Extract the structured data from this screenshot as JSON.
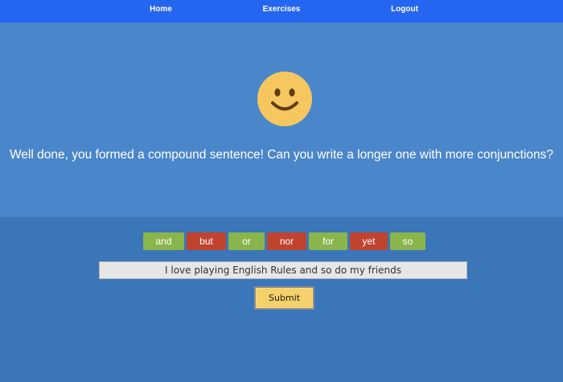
{
  "nav": {
    "home": "Home",
    "exercises": "Exercises",
    "logout": "Logout"
  },
  "feedback": {
    "icon": "smiley-face-icon",
    "message": "Well done, you formed a compound sentence! Can you write a longer one with more conjunctions?"
  },
  "conjunctions": [
    {
      "label": "and",
      "color": "#8ab54c"
    },
    {
      "label": "but",
      "color": "#c0432f"
    },
    {
      "label": "or",
      "color": "#8ab54c"
    },
    {
      "label": "nor",
      "color": "#c0432f"
    },
    {
      "label": "for",
      "color": "#8ab54c"
    },
    {
      "label": "yet",
      "color": "#c0432f"
    },
    {
      "label": "so",
      "color": "#8ab54c"
    }
  ],
  "sentence": {
    "value": "I love playing English Rules and so do my friends"
  },
  "submit": {
    "label": "Submit"
  },
  "colors": {
    "navbar": "#2566f0",
    "hero": "#4a86ca",
    "background": "#3b76b8",
    "submit": "#f5d16a"
  }
}
